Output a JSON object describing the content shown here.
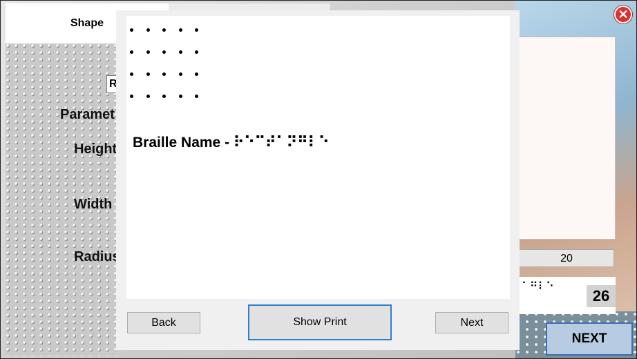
{
  "tabs": {
    "active_label": "Shape"
  },
  "form": {
    "ro_box_text": "R",
    "parameters_label": "Paramet",
    "height_label": "Height",
    "width_label": "Width",
    "radius_label": "Radius"
  },
  "dialog": {
    "braille_name_label": "Braille Name - ",
    "braille_name_value": "⠗⠑⠉⠞⠁⠝⠛⠇⠑",
    "back_label": "Back",
    "show_print_label": "Show Print",
    "next_label": "Next",
    "dot_grid": {
      "rows": 4,
      "cols": 5
    }
  },
  "right_panel": {
    "value_field": "20",
    "braille_text": "⠁⠛⠇⠑",
    "count": "26",
    "next_button": "NEXT"
  },
  "close_icon": "close-icon",
  "colors": {
    "accent_blue": "#2f7fd0",
    "next_bg": "#b7cbe2",
    "close_red": "#d93030"
  }
}
